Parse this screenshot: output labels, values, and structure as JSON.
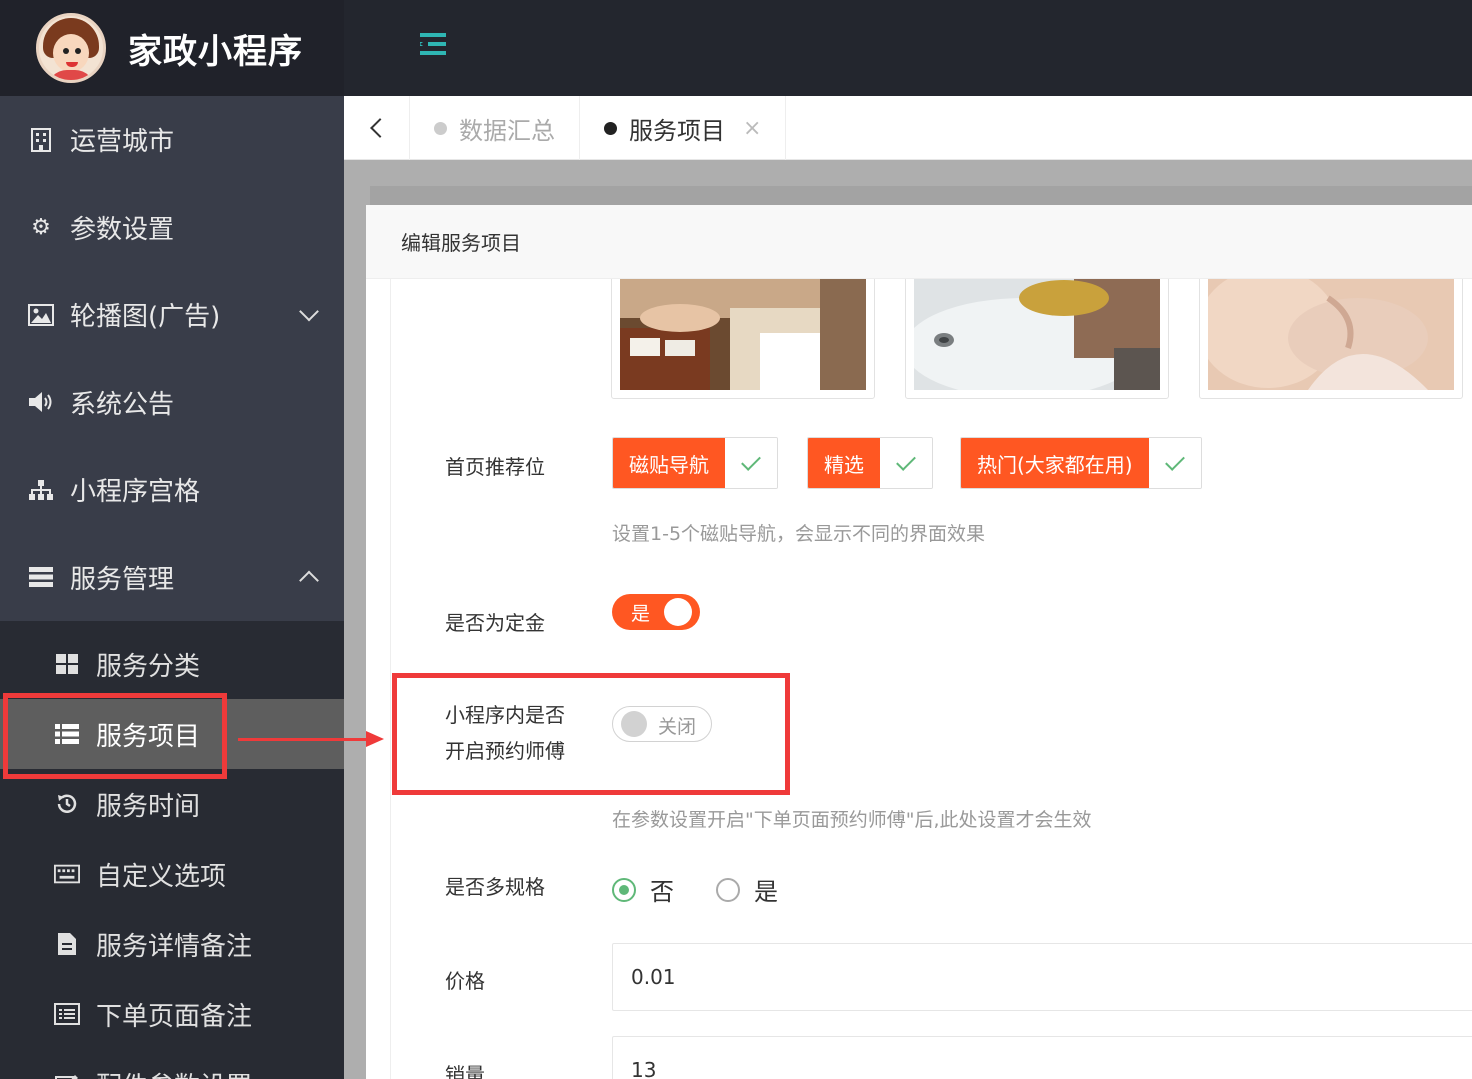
{
  "app": {
    "title": "家政小程序"
  },
  "sidebar": {
    "items": [
      {
        "label": "运营城市",
        "icon": "building-icon"
      },
      {
        "label": "参数设置",
        "icon": "gear-icon"
      },
      {
        "label": "轮播图(广告)",
        "icon": "image-icon",
        "expandable": true
      },
      {
        "label": "系统公告",
        "icon": "speaker-icon"
      },
      {
        "label": "小程序宫格",
        "icon": "sitemap-icon"
      },
      {
        "label": "服务管理",
        "icon": "server-icon",
        "expanded": true
      }
    ],
    "subitems": [
      {
        "label": "服务分类",
        "icon": "grid-icon"
      },
      {
        "label": "服务项目",
        "icon": "list-icon",
        "active": true
      },
      {
        "label": "服务时间",
        "icon": "history-icon"
      },
      {
        "label": "自定义选项",
        "icon": "keyboard-icon"
      },
      {
        "label": "服务详情备注",
        "icon": "file-icon"
      },
      {
        "label": "下单页面备注",
        "icon": "list-alt-icon"
      },
      {
        "label": "配件参数设置",
        "icon": "edit-icon"
      }
    ]
  },
  "tabs": [
    {
      "label": "数据汇总",
      "active": false
    },
    {
      "label": "服务项目",
      "active": true,
      "close": "×"
    }
  ],
  "dialog": {
    "title": "编辑服务项目",
    "form": {
      "recommend_label": "首页推荐位",
      "recommend_options": [
        "磁贴导航",
        "精选",
        "热门(大家都在用)"
      ],
      "recommend_hint": "设置1-5个磁贴导航，会显示不同的界面效果",
      "deposit_label": "是否为定金",
      "deposit_switch_text": "是",
      "booking_label_line1": "小程序内是否",
      "booking_label_line2": "开启预约师傅",
      "booking_switch_text": "关闭",
      "booking_hint": "在参数设置开启\"下单页面预约师傅\"后,此处设置才会生效",
      "multispec_label": "是否多规格",
      "multispec_options": [
        "否",
        "是"
      ],
      "multispec_selected": "否",
      "price_label": "价格",
      "price_value": "0.01",
      "sales_label": "销量",
      "sales_value": "13"
    }
  },
  "colors": {
    "accent": "#ff5722",
    "success": "#5fb878",
    "highlight": "#ef3a3a",
    "sidebar_bg": "#393d49",
    "topbar_bg": "#23262e"
  }
}
